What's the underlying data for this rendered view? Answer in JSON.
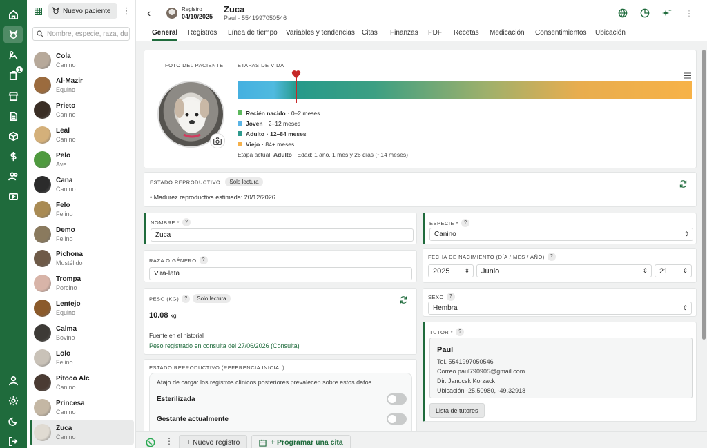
{
  "sidebar_rail": {
    "icons": [
      "home-icon",
      "pet-icon",
      "reception-icon",
      "documents-icon",
      "store-icon",
      "records-icon",
      "box-icon",
      "dollar-icon",
      "users-icon",
      "video-icon",
      "user-icon",
      "settings-icon",
      "dark-mode-icon",
      "logout-icon"
    ],
    "notification_count": "1"
  },
  "patient_list": {
    "new_patient_label": "Nuevo paciente",
    "search_placeholder": "Nombre, especie, raza, du",
    "patients": [
      {
        "name": "Cola",
        "species": "Canino"
      },
      {
        "name": "Al-Mazir",
        "species": "Equino"
      },
      {
        "name": "Prieto",
        "species": "Canino"
      },
      {
        "name": "Leal",
        "species": "Canino"
      },
      {
        "name": "Pelo",
        "species": "Ave"
      },
      {
        "name": "Cana",
        "species": "Canino"
      },
      {
        "name": "Felo",
        "species": "Felino"
      },
      {
        "name": "Demo",
        "species": "Felino"
      },
      {
        "name": "Pichona",
        "species": "Mustélido"
      },
      {
        "name": "Trompa",
        "species": "Porcino"
      },
      {
        "name": "Lentejo",
        "species": "Equino"
      },
      {
        "name": "Calma",
        "species": "Bovino"
      },
      {
        "name": "Lolo",
        "species": "Felino"
      },
      {
        "name": "Pitoco Alc",
        "species": "Canino"
      },
      {
        "name": "Princesa",
        "species": "Canino"
      },
      {
        "name": "Zuca",
        "species": "Canino"
      }
    ]
  },
  "header": {
    "registro_label": "Registro",
    "registro_date": "04/10/2025",
    "patient_name": "Zuca",
    "patient_sub": "Paul · 5541997050546"
  },
  "tabs": [
    "General",
    "Registros",
    "Línea de tiempo",
    "Variables y tendencias",
    "Citas",
    "Finanzas",
    "PDF",
    "Recetas",
    "Medicación",
    "Consentimientos",
    "Ubicación"
  ],
  "life_stages": {
    "photo_caption": "Foto del paciente",
    "stages_caption": "Etapas de vida",
    "legend": [
      {
        "name": "Recién nacido",
        "range": "· 0–2 meses",
        "color": "#5cb85c",
        "bold": false
      },
      {
        "name": "Joven",
        "range": "· 2–12 meses",
        "color": "#5ab4e5",
        "bold": false
      },
      {
        "name": "Adulto",
        "range": "· 12–84 meses",
        "color": "#2e9a8e",
        "bold": true
      },
      {
        "name": "Viejo",
        "range": "· 84+ meses",
        "color": "#f5b04a",
        "bold": false
      }
    ],
    "current_label": "Etapa actual:",
    "current_value": "Adulto",
    "age_text": "· Edad: 1 año, 1 mes y 26 días (~14 meses)"
  },
  "repro_status": {
    "caption": "Estado reproductivo",
    "pill": "Solo lectura",
    "maturity": "Madurez reproductiva estimada: 20/12/2026"
  },
  "form": {
    "nombre_label": "Nombre *",
    "nombre_value": "Zuca",
    "raza_label": "Raza o género",
    "raza_value": "Vira-lata",
    "peso_label": "Peso (kg)",
    "peso_pill": "Solo lectura",
    "peso_value": "10.08",
    "peso_unit": "kg",
    "peso_source_label": "Fuente en el historial",
    "peso_source_link": "Peso registrado en consulta del 27/06/2026 (Consulta)",
    "repro_ref_label": "Estado reproductivo (referencia inicial)",
    "repro_ref_hint": "Atajo de carga: los registros clínicos posteriores prevalecen sobre estos datos.",
    "esterilizada_label": "Esterilizada",
    "gestante_label": "Gestante actualmente",
    "especie_label": "Especie *",
    "especie_value": "Canino",
    "fecha_label": "Fecha de nacimiento (día / mes / año)",
    "fecha_year": "2025",
    "fecha_month": "Junio",
    "fecha_day": "21",
    "sexo_label": "Sexo",
    "sexo_value": "Hembra",
    "tutor_label": "Tutor *",
    "tutor_name": "Paul",
    "tutor_tel": "Tel. 5541997050546",
    "tutor_email": "Correo paul790905@gmail.com",
    "tutor_dir": "Dir. Janucsk Korzack",
    "tutor_loc": "Ubicación -25.50980, -49.32918",
    "tutor_list_btn": "Lista de tutores"
  },
  "bottom": {
    "new_record": "+ Nuevo registro",
    "schedule": "+ Programar una cita"
  },
  "colors": {
    "brand": "#1f6b3c",
    "accent_green": "#1f6b3c"
  }
}
